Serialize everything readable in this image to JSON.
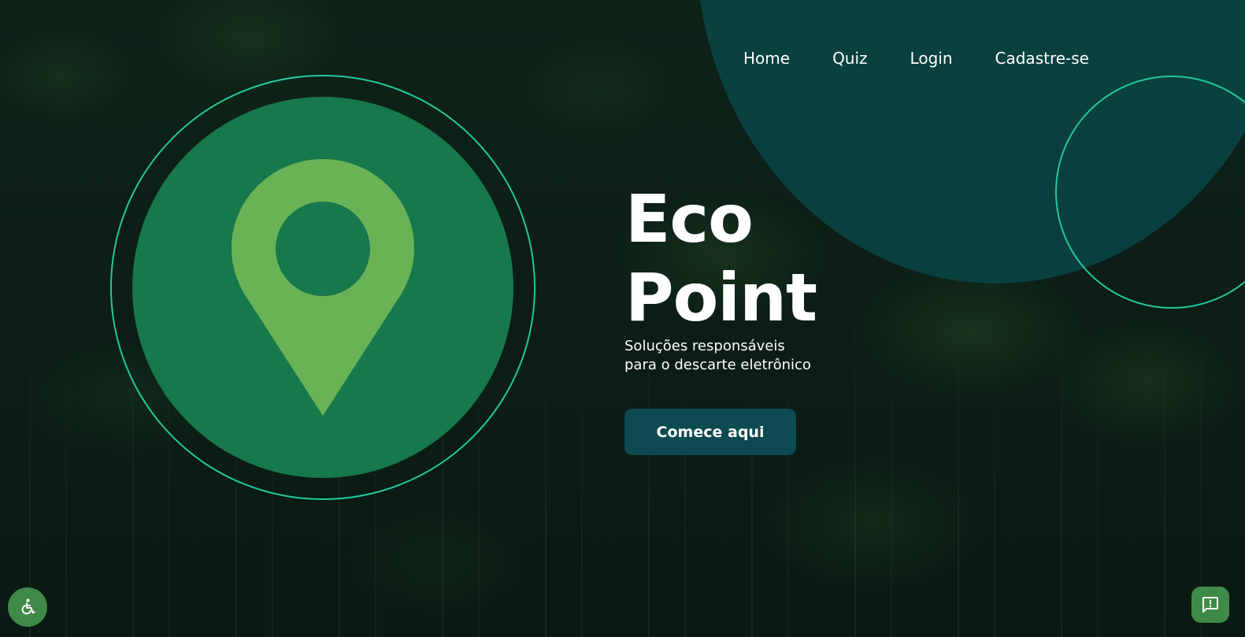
{
  "nav": {
    "items": [
      {
        "label": "Home"
      },
      {
        "label": "Quiz"
      },
      {
        "label": "Login"
      },
      {
        "label": "Cadastre-se"
      }
    ]
  },
  "logo": {
    "icon": "map-pin-icon",
    "circle_color": "#17784c",
    "pin_color": "#69b356",
    "ring_color": "#1fc99a"
  },
  "hero": {
    "title_line1": "Eco",
    "title_line2": "Point",
    "subtitle": "Soluções responsáveis para o descarte eletrônico",
    "cta_label": "Comece aqui"
  },
  "floating": {
    "accessibility_icon": "accessibility-wheelchair-icon",
    "feedback_icon": "feedback-alert-icon"
  },
  "colors": {
    "teal_blob": "#084848",
    "button_bg": "#0e4a52",
    "fab_bg": "#3f8a48"
  }
}
